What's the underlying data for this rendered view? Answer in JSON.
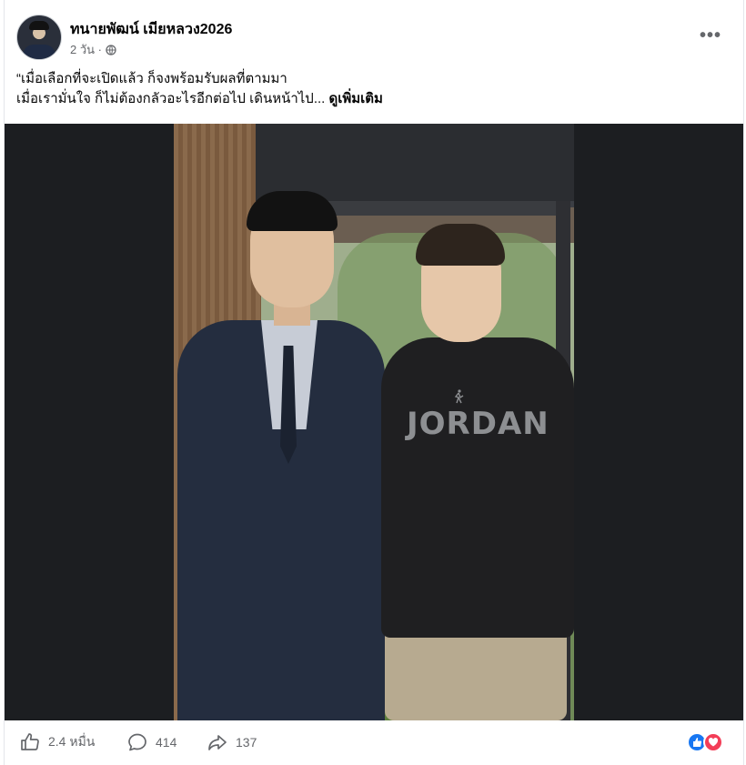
{
  "post": {
    "author": "ทนายพัฒน์ เมียหลวง2026",
    "time": "2 วัน ·",
    "privacy_icon": "globe-icon",
    "more_icon": "more-options-icon",
    "more_label": "•••",
    "caption": "“เมื่อเลือกที่จะเปิดแล้ว  ก็จงพร้อมรับผลที่ตามมา\nเมื่อเรามั่นใจ ก็ไม่ต้องกลัวอะไรอีกต่อไป   เดินหน้าไป...",
    "see_more": "ดูเพิ่มเติม",
    "photo": {
      "shirt_text": "JORDAN",
      "description_icon": "photo-image"
    }
  },
  "footer": {
    "likes": "2.4 หมื่น",
    "comments": "414",
    "shares": "137",
    "like_icon": "thumbs-up-icon",
    "comment_icon": "comment-icon",
    "share_icon": "share-icon",
    "reaction_icons": [
      "like-reaction-icon",
      "love-reaction-icon"
    ]
  },
  "colors": {
    "text_primary": "#050505",
    "text_secondary": "#65676b",
    "media_background": "#1c1e21",
    "like_blue": "#1877f2",
    "love_red": "#f33e58"
  }
}
